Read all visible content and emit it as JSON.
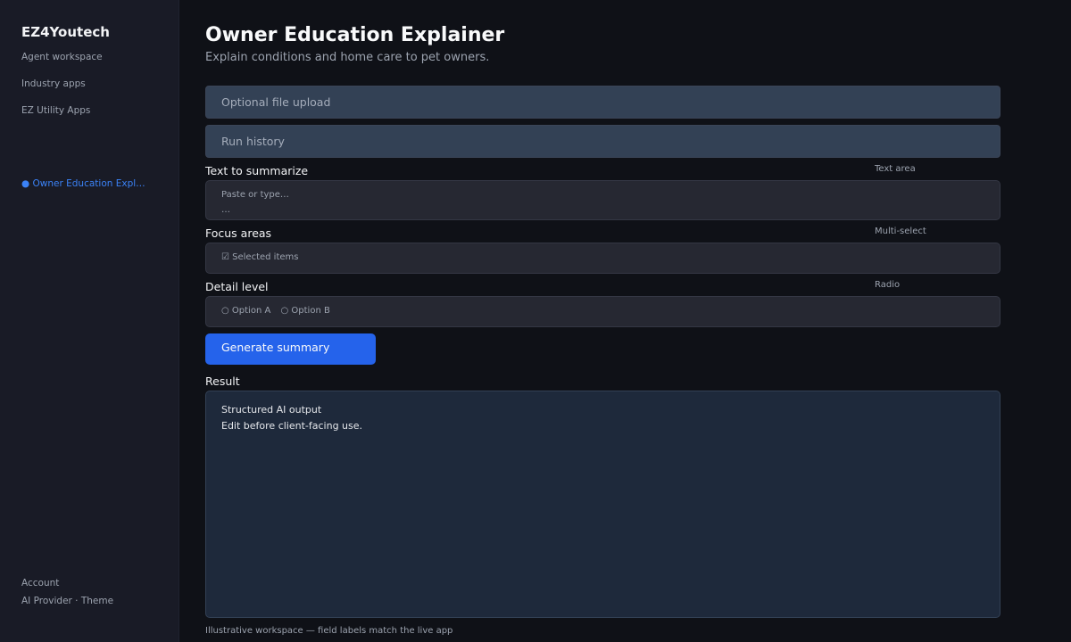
{
  "sidebar": {
    "brand": "EZ4Youtech",
    "nav": [
      "Agent workspace",
      "Industry apps",
      "EZ Utility Apps"
    ],
    "active_item": "● Owner Education Explainer",
    "footer": {
      "account": "Account",
      "settings": "AI Provider · Theme"
    }
  },
  "header": {
    "title": "Owner Education Explainer",
    "subtitle": "Explain conditions and home care to pet owners."
  },
  "bars": {
    "upload": "Optional file upload",
    "history": "Run history"
  },
  "fields": {
    "text": {
      "label": "Text to summarize",
      "type": "Text area",
      "placeholder": "Paste or type…",
      "ellipsis": "…"
    },
    "focus": {
      "label": "Focus areas",
      "type": "Multi-select",
      "value": "☑ Selected items"
    },
    "detail": {
      "label": "Detail level",
      "type": "Radio",
      "option_a": "○ Option A",
      "option_b": "○ Option B"
    }
  },
  "action": {
    "generate_label": "Generate summary"
  },
  "result": {
    "label": "Result",
    "line1": "Structured AI output",
    "line2": "Edit before client-facing use."
  },
  "footnote": "Illustrative workspace — field labels match the live app"
}
